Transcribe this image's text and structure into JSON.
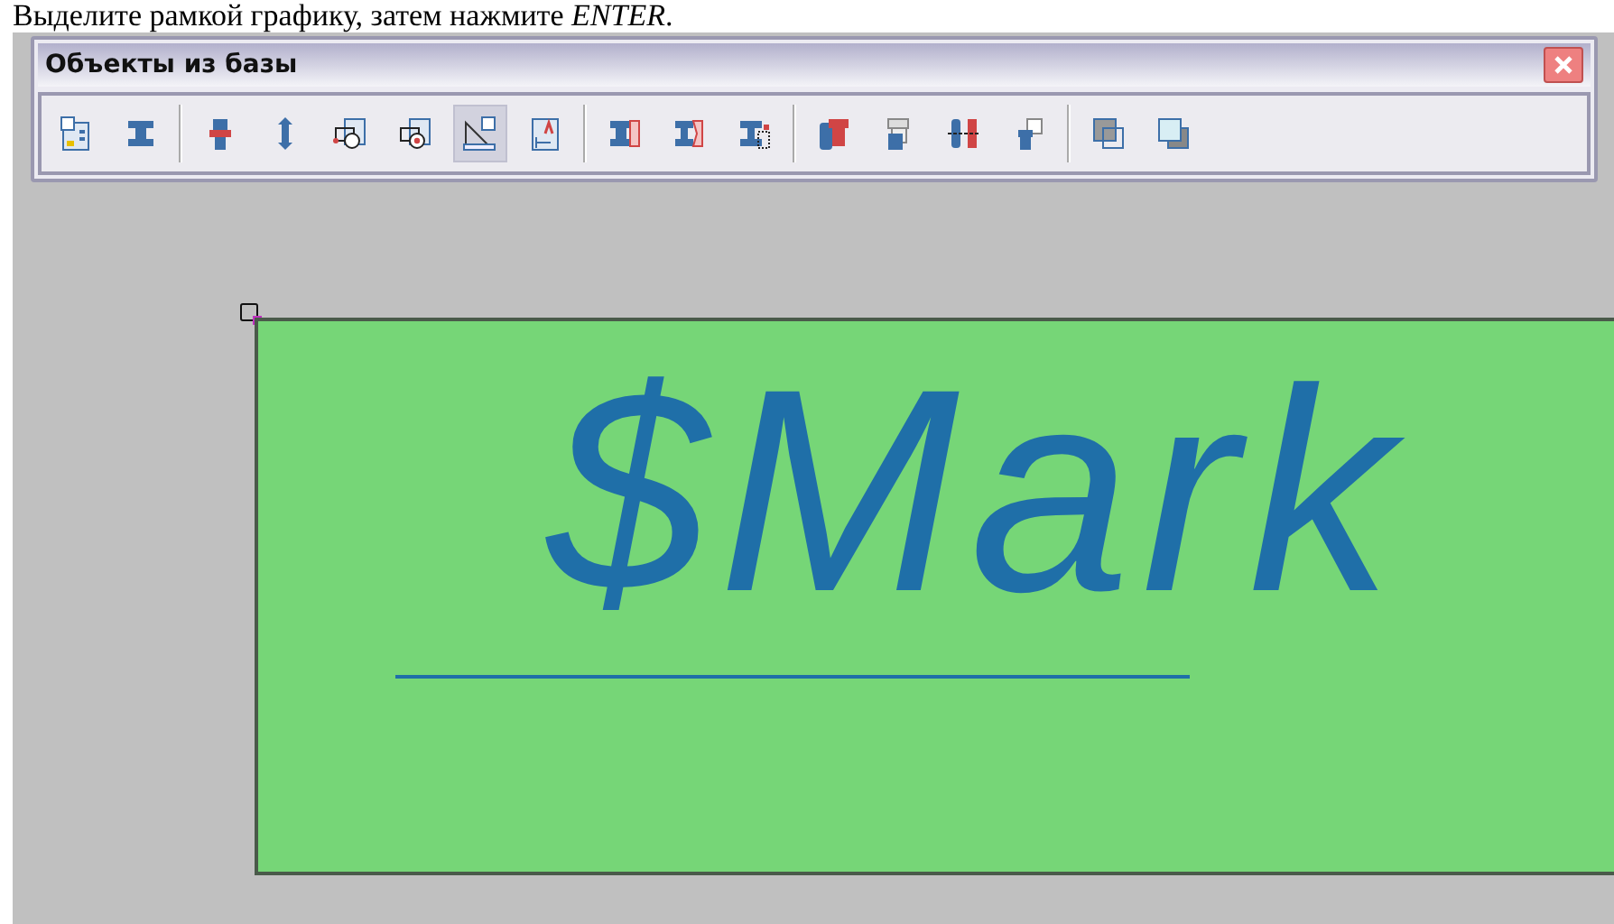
{
  "prompt": "Выделите рамкой графику, затем нажмите *ENTER*.",
  "window": {
    "title": "Объекты из базы"
  },
  "toolbar": {
    "groups": [
      [
        {
          "selected": false
        },
        {
          "selected": false
        }
      ],
      [
        {
          "selected": false
        },
        {
          "selected": false
        },
        {
          "selected": false
        },
        {
          "selected": false
        },
        {
          "selected": true
        },
        {
          "selected": false
        }
      ],
      [
        {
          "selected": false
        },
        {
          "selected": false
        },
        {
          "selected": false
        }
      ],
      [
        {
          "selected": false
        },
        {
          "selected": false
        },
        {
          "selected": false
        },
        {
          "selected": false
        }
      ],
      [
        {
          "selected": false
        },
        {
          "selected": false
        }
      ]
    ]
  },
  "canvas": {
    "label": "$Mark"
  }
}
